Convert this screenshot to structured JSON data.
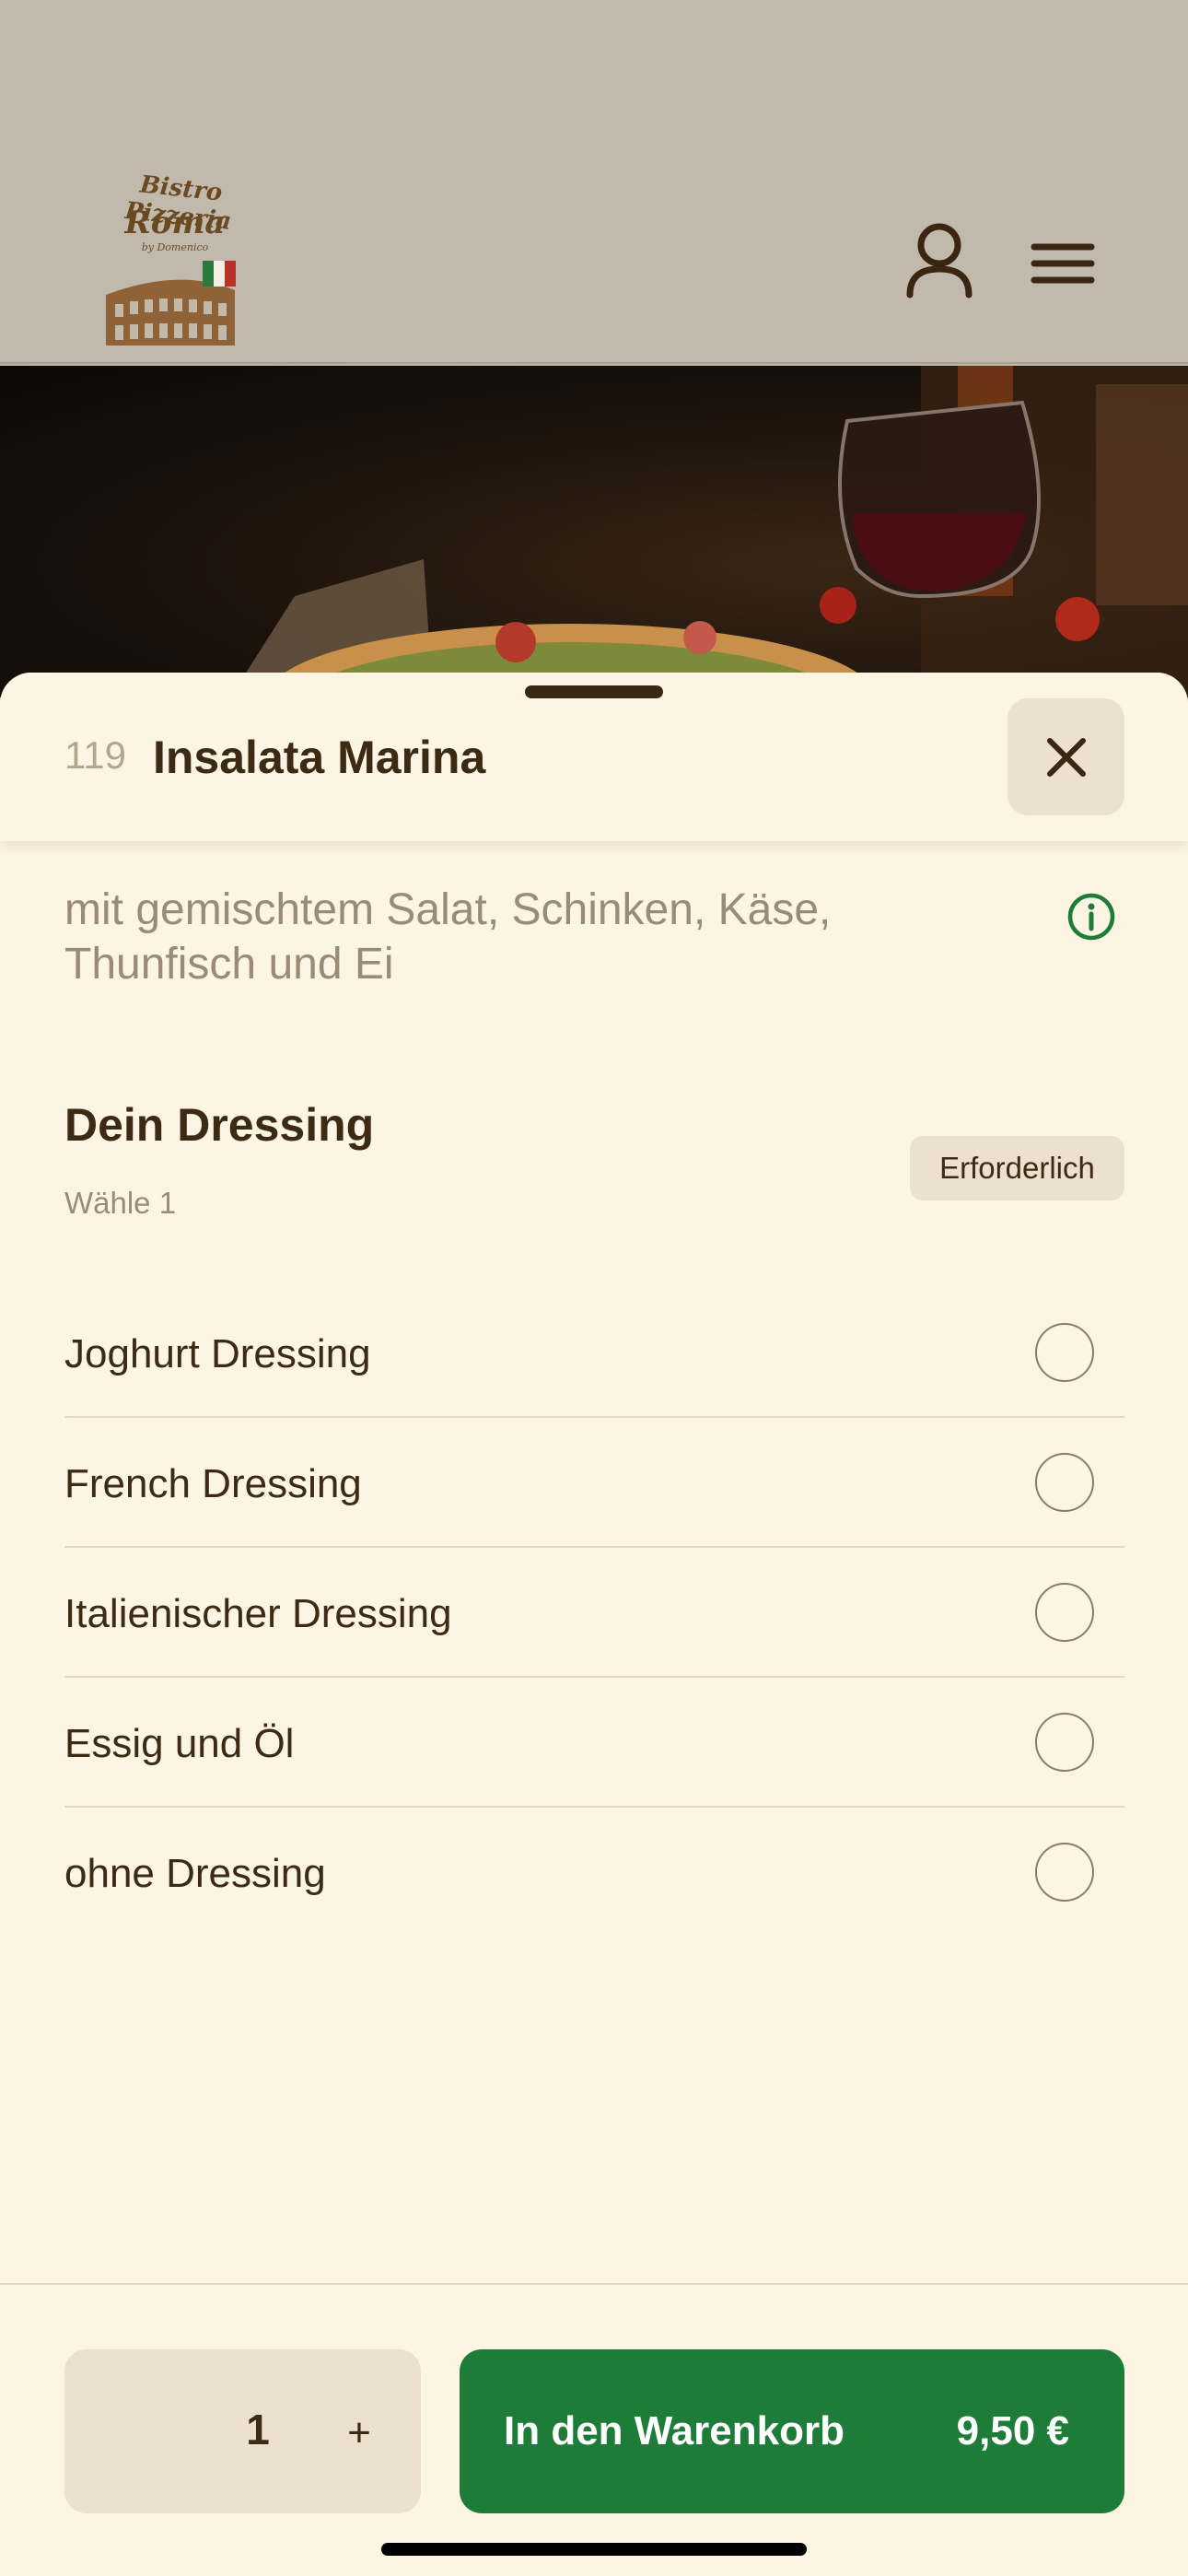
{
  "header": {
    "logo": {
      "line1": "Bistro Pizzeria",
      "line2": "Roma",
      "line3": "by Domenico"
    },
    "user_icon": "user-icon",
    "menu_icon": "hamburger-menu-icon"
  },
  "item": {
    "number": "119",
    "title": "Insalata Marina",
    "description": "mit gemischtem Salat, Schinken, Käse, Thunfisch und Ei"
  },
  "options_group": {
    "title": "Dein Dressing",
    "subtitle": "Wähle 1",
    "badge": "Erforderlich",
    "options": [
      {
        "label": "Joghurt Dressing",
        "selected": false
      },
      {
        "label": "French Dressing",
        "selected": false
      },
      {
        "label": "Italienischer Dressing",
        "selected": false
      },
      {
        "label": "Essig und Öl",
        "selected": false
      },
      {
        "label": "ohne Dressing",
        "selected": false
      }
    ]
  },
  "footer": {
    "quantity": "1",
    "plus_label": "+",
    "cart_label": "In den Warenkorb",
    "price": "9,50 €"
  },
  "colors": {
    "accent_green": "#1d7c38",
    "sheet_bg": "#fdf5e4",
    "text_brown": "#3d2a14",
    "muted": "#9a8b76"
  }
}
